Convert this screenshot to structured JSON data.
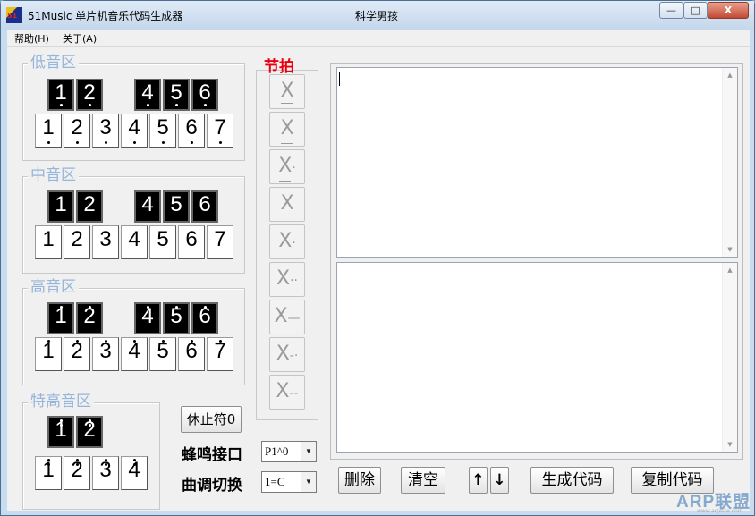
{
  "window": {
    "title": "51Music 单片机音乐代码生成器",
    "center_title": "科学男孩",
    "controls": {
      "minimize": "—",
      "maximize": "□",
      "close": "X"
    }
  },
  "menu": [
    "帮助(H)",
    "关于(A)"
  ],
  "groups": [
    {
      "title": "低音区",
      "black": [
        "1",
        "2",
        "4",
        "5",
        "6"
      ],
      "white": [
        "1",
        "2",
        "3",
        "4",
        "5",
        "6",
        "7"
      ],
      "dots_above": 0,
      "dots_below": 1
    },
    {
      "title": "中音区",
      "black": [
        "1",
        "2",
        "4",
        "5",
        "6"
      ],
      "white": [
        "1",
        "2",
        "3",
        "4",
        "5",
        "6",
        "7"
      ],
      "dots_above": 0,
      "dots_below": 0
    },
    {
      "title": "高音区",
      "black": [
        "1",
        "2",
        "4",
        "5",
        "6"
      ],
      "white": [
        "1",
        "2",
        "3",
        "4",
        "5",
        "6",
        "7"
      ],
      "dots_above": 1,
      "dots_below": 0
    },
    {
      "title": "特高音区",
      "black": [
        "1",
        "2"
      ],
      "white": [
        "1",
        "2",
        "3",
        "4"
      ],
      "dots_above": 2,
      "dots_below": 0
    }
  ],
  "tempo": {
    "title": "节拍",
    "buttons": [
      {
        "base": "X",
        "underlines": 2,
        "suffix": ""
      },
      {
        "base": "X",
        "underlines": 1,
        "suffix": ""
      },
      {
        "base": "X",
        "underlines": 1,
        "suffix": "·"
      },
      {
        "base": "X",
        "underlines": 0,
        "suffix": ""
      },
      {
        "base": "X",
        "underlines": 0,
        "suffix": "·"
      },
      {
        "base": "X",
        "underlines": 0,
        "suffix": "··"
      },
      {
        "base": "X",
        "underlines": 0,
        "suffix": "—"
      },
      {
        "base": "X",
        "underlines": 0,
        "suffix": "-·"
      },
      {
        "base": "X",
        "underlines": 0,
        "suffix": "--"
      }
    ]
  },
  "rest_button": "休止符0",
  "buzzer": {
    "label": "蜂鸣接口",
    "value": "P1^0"
  },
  "key": {
    "label": "曲调切换",
    "value": "1=C"
  },
  "actions": {
    "delete": "删除",
    "clear": "清空",
    "up": "↑",
    "down": "↓",
    "generate": "生成代码",
    "copy": "复制代码"
  },
  "watermark": {
    "main": "ARP联盟",
    "sub": "www.arpsite.com"
  }
}
